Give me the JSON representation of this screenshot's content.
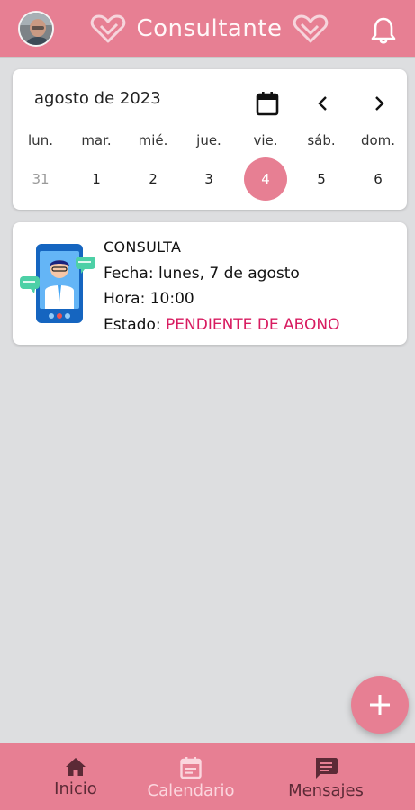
{
  "header": {
    "title": "Consultante",
    "avatar_icon": "user-avatar",
    "notification_icon": "bell-icon",
    "brand_icon": "heart-icon",
    "color": "#e77f93"
  },
  "calendar": {
    "month_label": "agosto de 2023",
    "calendar_icon": "calendar-icon",
    "prev_icon": "chevron-left-icon",
    "next_icon": "chevron-right-icon",
    "weekdays": [
      "lun.",
      "mar.",
      "mié.",
      "jue.",
      "vie.",
      "sáb.",
      "dom."
    ],
    "days": [
      "31",
      "1",
      "2",
      "3",
      "4",
      "5",
      "6"
    ],
    "selected_day": "4"
  },
  "appointment": {
    "title": "CONSULTA",
    "date_label": "Fecha:",
    "date_value": "lunes, 7 de agosto",
    "time_label": "Hora:",
    "time_value": "10:00",
    "status_label": "Estado:",
    "status_value": "PENDIENTE DE ABONO",
    "status_color": "#d81b60",
    "illustration": "doctor-video-call-icon"
  },
  "fab": {
    "icon": "plus-icon"
  },
  "bottom_nav": {
    "items": [
      {
        "label": "Inicio",
        "icon": "home-icon"
      },
      {
        "label": "Calendario",
        "icon": "calendar-icon"
      },
      {
        "label": "Mensajes",
        "icon": "message-icon"
      }
    ]
  }
}
